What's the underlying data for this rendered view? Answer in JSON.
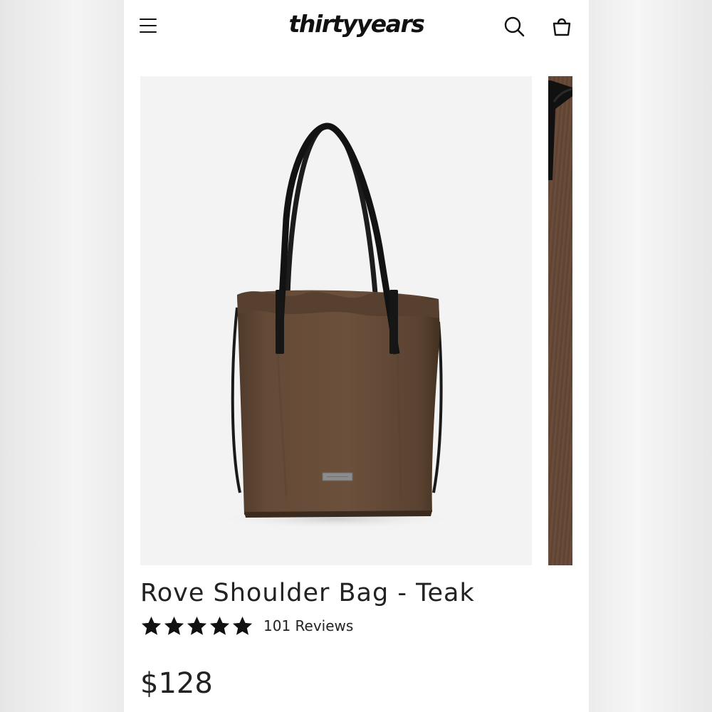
{
  "header": {
    "logo_text": "thirtyyears",
    "menu_icon": "hamburger-menu-icon",
    "search_icon": "search-icon",
    "cart_icon": "shopping-bag-icon"
  },
  "product": {
    "title": "Rove Shoulder Bag - Teak",
    "rating": 5,
    "rating_max": 5,
    "reviews_label": "101 Reviews",
    "price": "$128",
    "image": "Brown drawstring tote bag with black leather shoulder straps",
    "color_hex": "#5e4433"
  },
  "gallery": {
    "slides_visible": 2
  }
}
